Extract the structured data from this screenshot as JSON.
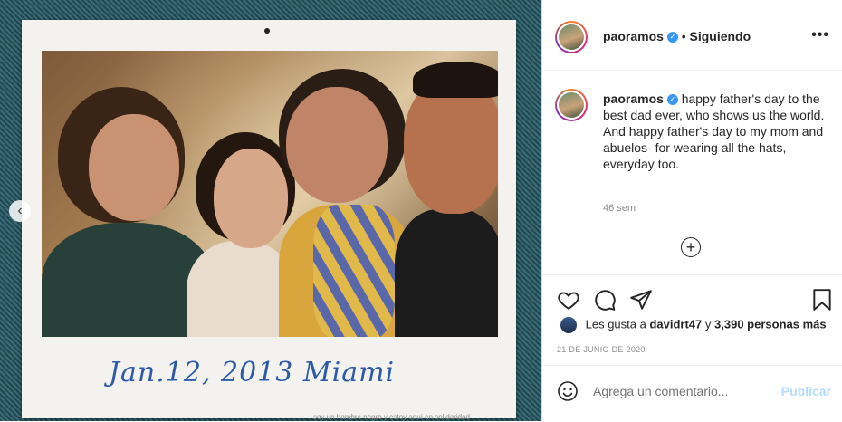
{
  "photo": {
    "caption": "Jan.12, 2013 Miami",
    "bottom_text": "soy un hombre negro y estoy aquí en solidaridad"
  },
  "header": {
    "username": "paoramos",
    "separator": "•",
    "follow_status": "Siguiendo",
    "more": "•••"
  },
  "post": {
    "username": "paoramos",
    "text_line1": "happy father's day to the best dad ever, who shows us the world.",
    "text_line2": "And happy father's day to my mom and abuelos- for wearing all the hats, everyday too.",
    "time": "46 sem",
    "load_more": "+"
  },
  "likes": {
    "prefix": "Les gusta a",
    "user": "davidrt47",
    "mid": "y",
    "count": "3,390 personas más"
  },
  "date": "21 DE JUNIO DE 2020",
  "comment_box": {
    "placeholder": "Agrega un comentario...",
    "publish": "Publicar"
  },
  "icons": [
    "chevron-left-icon",
    "verified-icon",
    "more-icon",
    "heart-icon",
    "comment-icon",
    "share-icon",
    "bookmark-icon",
    "emoji-icon",
    "add-circle-icon"
  ],
  "colors": {
    "verified": "#3897f0",
    "publish_disabled": "#b3dbff",
    "muted": "#8e8e8e"
  }
}
